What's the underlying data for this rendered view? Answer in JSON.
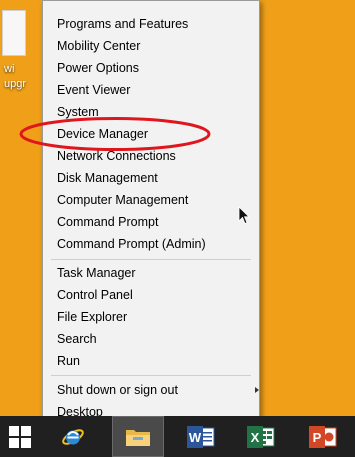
{
  "desktop": {
    "background_color": "#f0a018",
    "icon_label": "wi\nupgr"
  },
  "menu": {
    "groups": [
      [
        {
          "label": "Programs and Features"
        },
        {
          "label": "Mobility Center"
        },
        {
          "label": "Power Options"
        },
        {
          "label": "Event Viewer"
        },
        {
          "label": "System"
        },
        {
          "label": "Device Manager",
          "highlighted": true
        },
        {
          "label": "Network Connections"
        },
        {
          "label": "Disk Management"
        },
        {
          "label": "Computer Management"
        },
        {
          "label": "Command Prompt"
        },
        {
          "label": "Command Prompt (Admin)"
        }
      ],
      [
        {
          "label": "Task Manager"
        },
        {
          "label": "Control Panel"
        },
        {
          "label": "File Explorer"
        },
        {
          "label": "Search"
        },
        {
          "label": "Run"
        }
      ],
      [
        {
          "label": "Shut down or sign out",
          "submenu": true
        },
        {
          "label": "Desktop"
        }
      ]
    ],
    "highlight_color": "#e0161e"
  },
  "taskbar": {
    "apps": [
      {
        "name": "start",
        "icon": "windows-logo-icon"
      },
      {
        "name": "internet-explorer",
        "icon": "internet-explorer-icon"
      },
      {
        "name": "file-explorer",
        "icon": "file-explorer-icon",
        "active": true
      },
      {
        "name": "word",
        "icon": "word-icon",
        "letter": "W",
        "color": "#2b579a"
      },
      {
        "name": "excel",
        "icon": "excel-icon",
        "letter": "X",
        "color": "#217346"
      },
      {
        "name": "powerpoint",
        "icon": "powerpoint-icon",
        "letter": "P",
        "color": "#d24726"
      }
    ]
  }
}
